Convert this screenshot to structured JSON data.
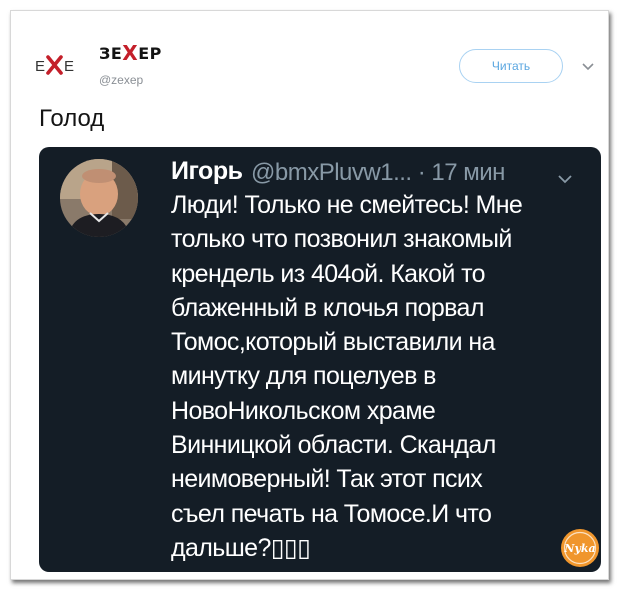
{
  "header": {
    "logo_text": "EXE",
    "author_name_left": "ЗЕ",
    "author_name_mark": "X",
    "author_name_right": "ЕР",
    "author_handle": "@zexep",
    "follow_label": "Читать"
  },
  "tweet": {
    "text": "Голод"
  },
  "embedded": {
    "author": "Игорь",
    "meta": "@bmxPluvw1... · 17 мин",
    "body_lines": [
      "Люди! Только не смейтесь! Мне",
      "только что позвонил знакомый",
      "крендель из 404ой. Какой то",
      "блаженный в клочья порвал",
      "Томос,который выставили на",
      "минутку для поцелуев в",
      "НовоНикольском храме",
      "Винницкой области. Скандал",
      "неимоверный! Так этот псих",
      "съел печать на Томосе.И что",
      "дальше?▯▯▯"
    ]
  },
  "watermark": {
    "text": "Nyka"
  },
  "icons": {
    "menu": "chevron-down-icon",
    "logo": "exe-logo-icon",
    "avatar": "user-avatar-photo",
    "watermark": "nyka-badge-icon"
  },
  "colors": {
    "accent": "#c41f2a",
    "follow_blue": "#5aa6e0",
    "embed_bg": "#141d26",
    "embed_meta": "#8899a6",
    "watermark_orange": "#f0962c"
  }
}
